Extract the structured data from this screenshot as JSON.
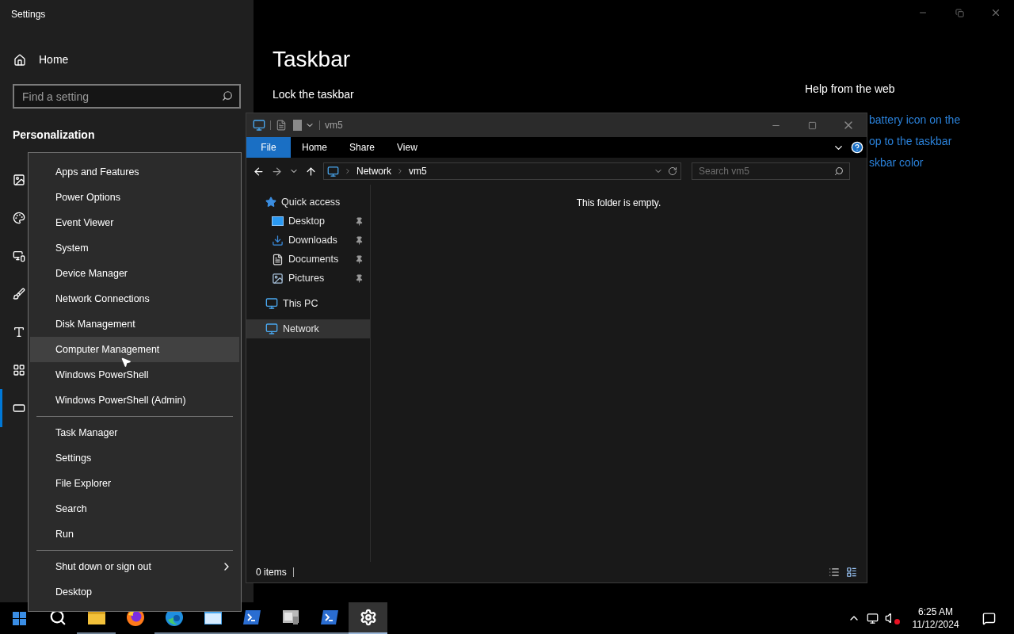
{
  "settings": {
    "title": "Settings",
    "home": "Home",
    "search": {
      "placeholder": "Find a setting"
    },
    "section": "Personalization",
    "nav_items": [
      {
        "selected": false
      },
      {
        "selected": false
      },
      {
        "selected": false
      },
      {
        "selected": false
      },
      {
        "selected": false
      },
      {
        "selected": false
      },
      {
        "selected": true
      }
    ],
    "page_title": "Taskbar",
    "lock_label": "Lock the taskbar",
    "help": {
      "title": "Help from the web",
      "links": [
        "battery icon on the",
        "op to the taskbar",
        "skbar color"
      ]
    }
  },
  "explorer": {
    "title": "vm5",
    "ribbon_tabs": [
      {
        "label": "File",
        "selected": true
      },
      {
        "label": "Home",
        "selected": false
      },
      {
        "label": "Share",
        "selected": false
      },
      {
        "label": "View",
        "selected": false
      }
    ],
    "breadcrumb": [
      "Network",
      "vm5"
    ],
    "search": {
      "placeholder": "Search vm5"
    },
    "nav": [
      {
        "label": "Quick access",
        "kind": "star",
        "selected": false,
        "children": [
          {
            "label": "Desktop",
            "kind": "desktop",
            "pinned": true,
            "selected": false
          },
          {
            "label": "Downloads",
            "kind": "downloads",
            "pinned": true,
            "selected": false
          },
          {
            "label": "Documents",
            "kind": "documents",
            "pinned": true,
            "selected": false
          },
          {
            "label": "Pictures",
            "kind": "pictures",
            "pinned": true,
            "selected": false
          }
        ]
      },
      {
        "label": "This PC",
        "kind": "pc",
        "selected": false
      },
      {
        "label": "Network",
        "kind": "network",
        "selected": true
      }
    ],
    "empty_message": "This folder is empty.",
    "status": "0 items"
  },
  "context_menu": [
    {
      "kind": "item",
      "label": "Apps and Features",
      "selected": false
    },
    {
      "kind": "item",
      "label": "Power Options",
      "selected": false
    },
    {
      "kind": "item",
      "label": "Event Viewer",
      "selected": false
    },
    {
      "kind": "item",
      "label": "System",
      "selected": false
    },
    {
      "kind": "item",
      "label": "Device Manager",
      "selected": false
    },
    {
      "kind": "item",
      "label": "Network Connections",
      "selected": false
    },
    {
      "kind": "item",
      "label": "Disk Management",
      "selected": false
    },
    {
      "kind": "item",
      "label": "Computer Management",
      "selected": true
    },
    {
      "kind": "item",
      "label": "Windows PowerShell",
      "selected": false
    },
    {
      "kind": "item",
      "label": "Windows PowerShell (Admin)",
      "selected": false
    },
    {
      "kind": "separator"
    },
    {
      "kind": "item",
      "label": "Task Manager",
      "selected": false
    },
    {
      "kind": "item",
      "label": "Settings",
      "selected": false
    },
    {
      "kind": "item",
      "label": "File Explorer",
      "selected": false
    },
    {
      "kind": "item",
      "label": "Search",
      "selected": false
    },
    {
      "kind": "item",
      "label": "Run",
      "selected": false
    },
    {
      "kind": "separator"
    },
    {
      "kind": "submenu",
      "label": "Shut down or sign out",
      "selected": false
    },
    {
      "kind": "item",
      "label": "Desktop",
      "selected": false
    }
  ],
  "taskbar": {
    "apps": [
      {
        "kind": "search",
        "running": false,
        "selected": false
      },
      {
        "kind": "folder",
        "running": true,
        "selected": false
      },
      {
        "kind": "firefox",
        "running": false,
        "selected": false
      },
      {
        "kind": "edge",
        "running": true,
        "selected": false
      },
      {
        "kind": "console",
        "running": true,
        "selected": false
      },
      {
        "kind": "terminal",
        "running": true,
        "selected": false
      },
      {
        "kind": "manager",
        "running": true,
        "selected": false
      },
      {
        "kind": "terminal",
        "running": true,
        "selected": false
      },
      {
        "kind": "settings",
        "running": true,
        "selected": true
      }
    ],
    "time": "6:25 AM",
    "date": "11/12/2024"
  }
}
